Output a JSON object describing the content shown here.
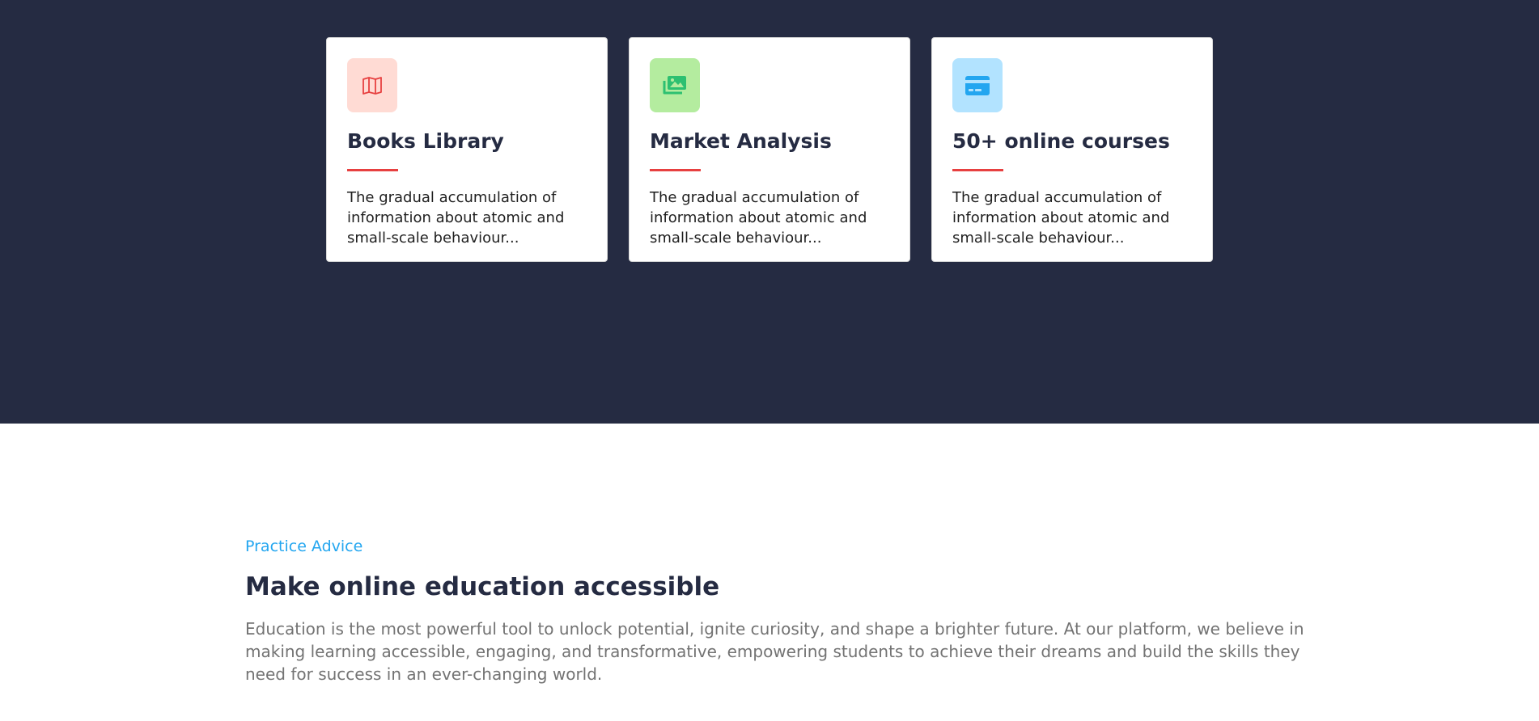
{
  "features": [
    {
      "title": "Books Library",
      "description": "The gradual accumulation of information about atomic and small-scale behaviour...",
      "icon": "map-icon",
      "icon_bg": "#ffdbd4",
      "icon_color": "#e74040"
    },
    {
      "title": "Market Analysis",
      "description": "The gradual accumulation of information about atomic and small-scale behaviour...",
      "icon": "images-icon",
      "icon_bg": "#b4ec9f",
      "icon_color": "#2dc071"
    },
    {
      "title": "50+ online courses",
      "description": "The gradual accumulation of information about atomic and small-scale behaviour...",
      "icon": "credit-card-icon",
      "icon_bg": "#b2e3ff",
      "icon_color": "#23a6f0"
    }
  ],
  "advice": {
    "eyebrow": "Practice Advice",
    "title": "Make online education accessible",
    "text": "Education is the most powerful tool to unlock potential, ignite curiosity, and shape a brighter future. At our platform, we believe in making learning accessible, engaging, and transformative, empowering students to achieve their dreams and build the skills they need for success in an ever-changing world."
  },
  "colors": {
    "hero_bg": "#252b42",
    "accent_line": "#e74040",
    "eyebrow": "#23a6f0"
  }
}
